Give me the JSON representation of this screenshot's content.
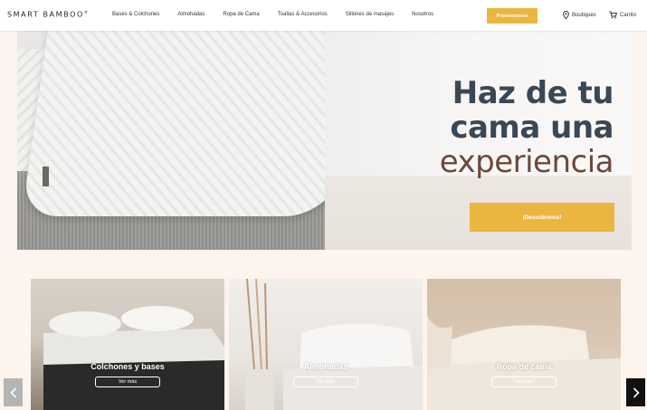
{
  "header": {
    "logo": "SMART BAMBOO",
    "logo_mark": "®",
    "nav": [
      "Bases & Colchones",
      "Almohadas",
      "Ropa de Cama",
      "Toallas & Accesorios",
      "Sillones de masajes",
      "Nosotros"
    ],
    "promo_label": "Promociones",
    "boutiques_label": "Boutiques",
    "cart_label": "Carrito"
  },
  "hero": {
    "line1": "Haz de tu",
    "line2": "cama una",
    "line3": "experiencia",
    "cta_label": "¡Descúbrelos!"
  },
  "categories": [
    {
      "label": "Colchones y bases",
      "more_label": "Ver más"
    },
    {
      "label": "Almohadas",
      "more_label": "Ver más"
    },
    {
      "label": "Ropa de cama",
      "more_label": "Ver más"
    }
  ],
  "carousel": {
    "prev_icon": "chevron-left-icon",
    "next_icon": "chevron-right-icon"
  },
  "colors": {
    "accent": "#ebb63f",
    "title_dark": "#3a4856",
    "title_brown": "#6b4a3a",
    "page_bg": "#fdf4ee"
  }
}
